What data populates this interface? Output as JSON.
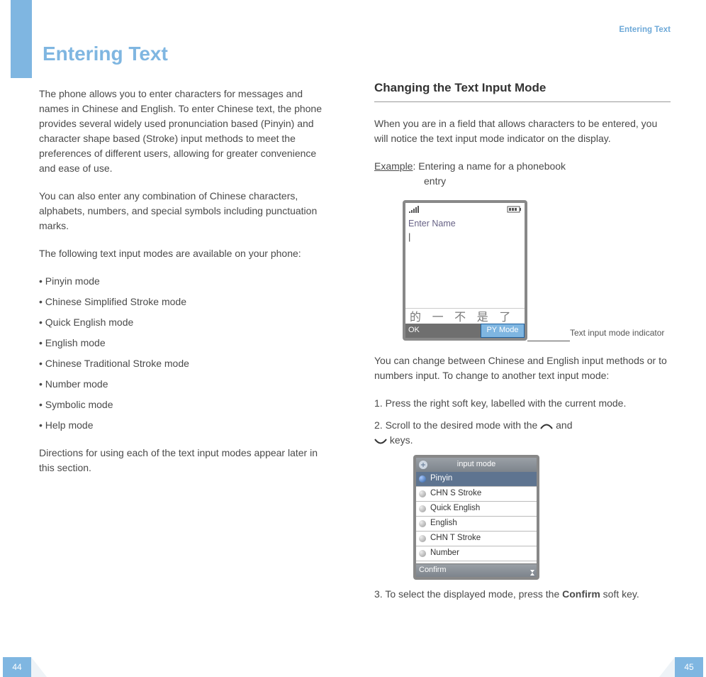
{
  "header_right": "Entering Text",
  "main_title": "Entering Text",
  "left": {
    "p1": "The phone allows you to enter characters for messages and names in Chinese and English. To enter Chinese text, the phone provides several widely used pronunciation based (Pinyin) and character shape based (Stroke) input methods to meet the preferences of different users, allowing for greater convenience and ease of use.",
    "p2": "You can also enter any combination of Chinese characters, alphabets, numbers, and special symbols including punctuation marks.",
    "p3": "The following text input modes are available on your phone:",
    "modes": [
      "• Pinyin mode",
      "• Chinese Simplified Stroke mode",
      "• Quick English mode",
      "• English mode",
      "• Chinese Traditional Stroke mode",
      "• Number mode",
      "• Symbolic mode",
      "• Help mode"
    ],
    "p4": "Directions for using each of the text input modes appear later in this section."
  },
  "right": {
    "section_title": "Changing the Text Input Mode",
    "intro": "When you are in a field that allows characters to be entered, you will notice the text input mode indicator on the display.",
    "example_label": "Example",
    "example_text": ": Entering a name for a phonebook",
    "example_sub": "entry",
    "screen1": {
      "title": "Enter Name",
      "candidates": "的 一 不  是 了",
      "sk_left": "OK",
      "sk_right": "PY Mode"
    },
    "callout": "Text input mode indicator",
    "after_screen": "You can change between Chinese and English input methods or to numbers input. To change to another text input mode:",
    "step1": "1. Press the right soft key, labelled with the current mode.",
    "step2a": "2. Scroll to the desired mode with the ",
    "step2b": " and ",
    "step2c": " keys.",
    "screen2": {
      "title": "input mode",
      "items": [
        "Pinyin",
        "CHN S Stroke",
        "Quick English",
        "English",
        "CHN T Stroke",
        "Number"
      ],
      "selected_index": 0,
      "sk_left": "Confirm"
    },
    "step3a": "3. To select the displayed mode, press the ",
    "step3_bold": "Confirm",
    "step3b": " soft key."
  },
  "page_left": "44",
  "page_right": "45"
}
